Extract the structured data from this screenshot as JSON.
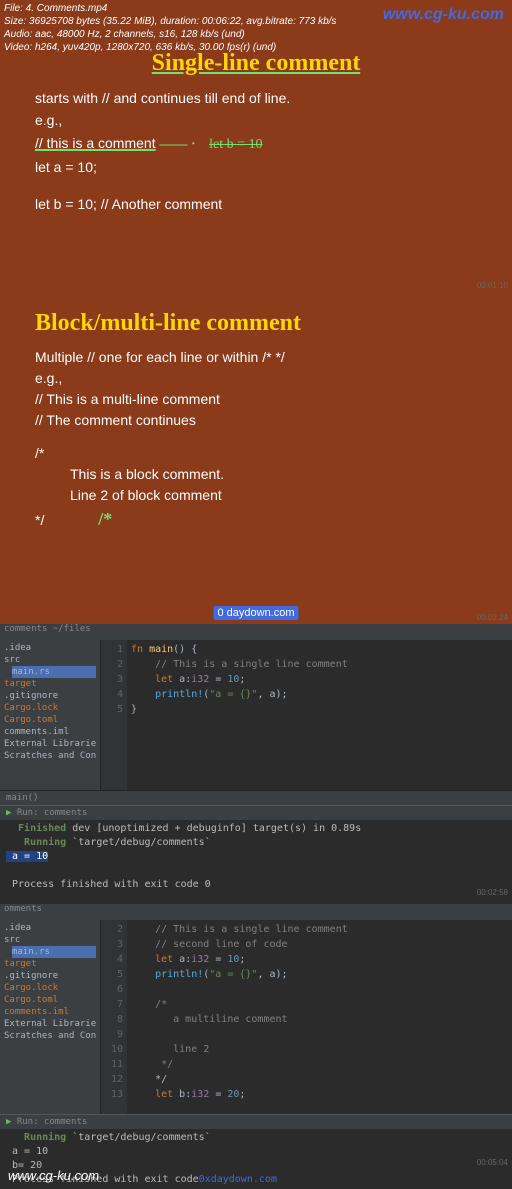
{
  "meta": {
    "line1": "File: 4. Comments.mp4",
    "line2": "Size: 36925708 bytes (35.22 MiB), duration: 00:06:22, avg.bitrate: 773 kb/s",
    "line3": "Audio: aac, 48000 Hz, 2 channels, s16, 128 kb/s (und)",
    "line4": "Video: h264, yuv420p, 1280x720, 636 kb/s, 30.00 fps(r) (und)"
  },
  "watermarks": {
    "top": "www.cg-ku.com",
    "bottom": "www.cg-ku.com",
    "center": "0 daydown.com",
    "center2": "0xdaydown.com"
  },
  "slide1": {
    "title": "Single-line comment",
    "l1": "starts with // and continues till end of line.",
    "l2": "e.g.,",
    "l3": "// this is a comment",
    "scribble": "let b = 10",
    "l4": "let a = 10;",
    "l5": "let b = 10; // Another comment",
    "ts": "00:01:10"
  },
  "slide2": {
    "title": "Block/multi-line comment",
    "l1": "Multiple // one for each line or within /*  */",
    "l2": "e.g.,",
    "l3": "// This is a multi-line comment",
    "l4": "// The comment continues",
    "l5": "/*",
    "l6": "This is a block comment.",
    "l7": "Line 2 of block comment",
    "l8": "*/",
    "annot1": "( ( ( '._' ) ) )",
    "annot_brace": "}",
    "annot_star1": "/*",
    "annot_dash": "— — -_ ",
    "annot_star2": "*/",
    "annot_bottom": "/*",
    "ts": "00:02:24"
  },
  "ide1": {
    "tabtext": "comments ~/files",
    "sidebar": [
      {
        "txt": ".idea",
        "cls": "folder"
      },
      {
        "txt": "src",
        "cls": "folder"
      },
      {
        "txt": "main.rs",
        "cls": "file-main"
      },
      {
        "txt": "target",
        "cls": "file-rust"
      },
      {
        "txt": ".gitignore",
        "cls": "folder"
      },
      {
        "txt": "Cargo.lock",
        "cls": "file-rust"
      },
      {
        "txt": "Cargo.toml",
        "cls": "file-rust"
      },
      {
        "txt": "comments.iml",
        "cls": "folder"
      },
      {
        "txt": "External Libraries",
        "cls": "folder"
      },
      {
        "txt": "Scratches and Con",
        "cls": "folder"
      }
    ],
    "gutters": [
      "1",
      "2",
      "3",
      "4",
      "5"
    ],
    "code": {
      "l1a": "fn ",
      "l1b": "main",
      "l1c": "() {",
      "l2": "    // This is a single line comment",
      "l3a": "    let ",
      "l3b": "a",
      "l3c": ":",
      "l3d": "i32",
      "l3e": " = ",
      "l3f": "10",
      "l3g": ";",
      "l4a": "    println!",
      "l4b": "(",
      "l4c": "\"a = {}\"",
      "l4d": ", a);",
      "l5": "}"
    },
    "breadcrumb": "main()",
    "runTab": "Run: comments",
    "term": {
      "l1a": "  Finished",
      "l1b": " dev [unoptimized + debuginfo] target(s) in 0.89s",
      "l2a": "   Running",
      "l2b": " `target/debug/comments`",
      "l3": " a = 10",
      "l4": "",
      "l5": " Process finished with exit code 0"
    },
    "ts": "00:02:58"
  },
  "ide2": {
    "tab": "omments",
    "sidebar": [
      {
        "txt": ".idea",
        "cls": "folder"
      },
      {
        "txt": "src",
        "cls": "folder"
      },
      {
        "txt": "main.rs",
        "cls": "file-main"
      },
      {
        "txt": "target",
        "cls": "file-rust"
      },
      {
        "txt": ".gitignore",
        "cls": "folder"
      },
      {
        "txt": "Cargo.lock",
        "cls": "file-rust"
      },
      {
        "txt": "Cargo.toml",
        "cls": "file-rust"
      },
      {
        "txt": "comments.iml",
        "cls": "file-rust"
      },
      {
        "txt": "External Libraries",
        "cls": "folder"
      },
      {
        "txt": "Scratches and Con",
        "cls": "folder"
      }
    ],
    "gutters": [
      "2",
      "3",
      "4",
      "5",
      "6",
      "7",
      "8",
      "9",
      "10",
      "11",
      "12",
      "13"
    ],
    "code": {
      "l1": "    // This is a single line comment",
      "l2": "    // second line of code",
      "l3a": "    let ",
      "l3b": "a",
      "l3c": ":",
      "l3d": "i32",
      "l3e": " = ",
      "l3f": "10",
      "l3g": ";",
      "l4a": "    println!",
      "l4b": "(",
      "l4c": "\"a = {}\"",
      "l4d": ", a);",
      "l5": "",
      "l6": "    /*",
      "l7": "       a multiline comment",
      "l8": "",
      "l9": "       line 2",
      "l10": "     */",
      "l11": "    */",
      "l12a": "    let ",
      "l12b": "b",
      "l12c": ":",
      "l12d": "i32",
      "l12e": " = ",
      "l12f": "20",
      "l12g": ";"
    },
    "breadcrumb": "main()",
    "runTab": "Run: comments",
    "term": {
      "l1a": "   Running",
      "l1b": " `target/debug/comments`",
      "l2": " a = 10",
      "l3": " b= 20",
      "l4": " Process finished with exit code"
    },
    "ts": "00:05:04"
  }
}
